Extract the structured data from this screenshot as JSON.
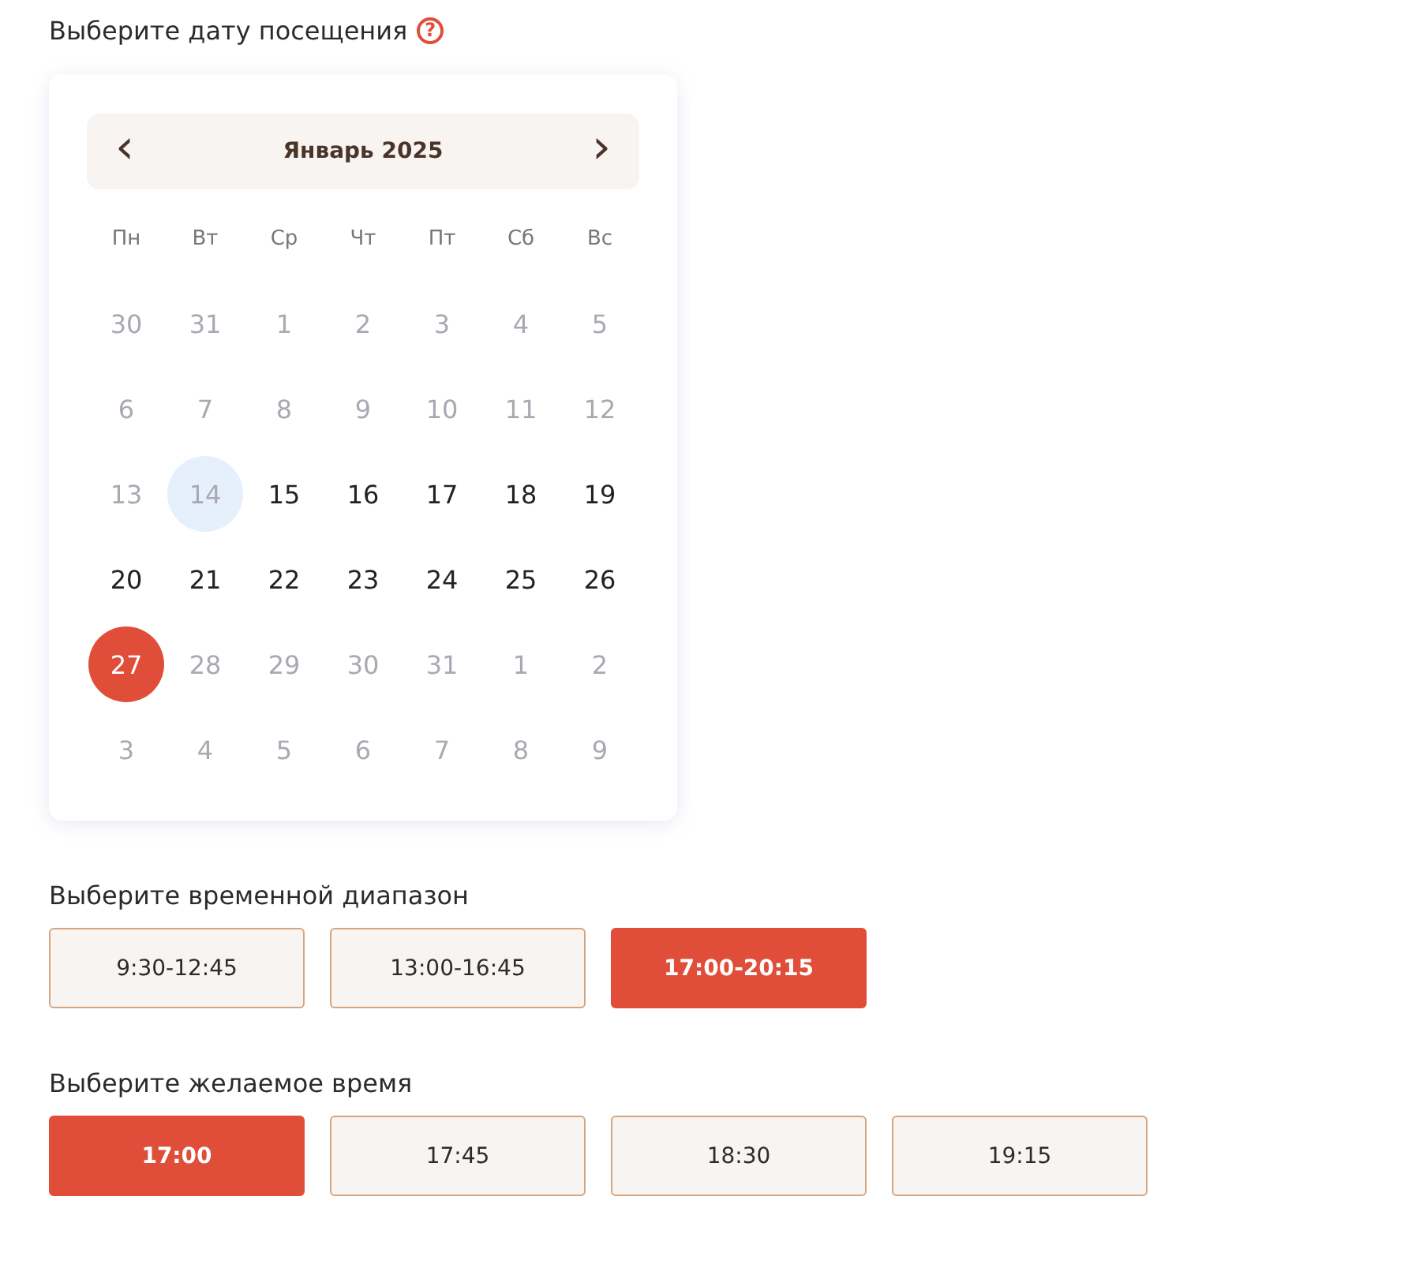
{
  "date_section": {
    "title": "Выберите дату посещения",
    "help_icon": "?"
  },
  "calendar": {
    "month": "Январь 2025",
    "prev": "‹",
    "next": "›",
    "weekdays": [
      "Пн",
      "Вт",
      "Ср",
      "Чт",
      "Пт",
      "Сб",
      "Вс"
    ],
    "weeks": [
      [
        {
          "day": "30",
          "disabled": true,
          "selected": false,
          "highlighted": false
        },
        {
          "day": "31",
          "disabled": true,
          "selected": false,
          "highlighted": false
        },
        {
          "day": "1",
          "disabled": true,
          "selected": false,
          "highlighted": false
        },
        {
          "day": "2",
          "disabled": true,
          "selected": false,
          "highlighted": false
        },
        {
          "day": "3",
          "disabled": true,
          "selected": false,
          "highlighted": false
        },
        {
          "day": "4",
          "disabled": true,
          "selected": false,
          "highlighted": false
        },
        {
          "day": "5",
          "disabled": true,
          "selected": false,
          "highlighted": false
        }
      ],
      [
        {
          "day": "6",
          "disabled": true,
          "selected": false,
          "highlighted": false
        },
        {
          "day": "7",
          "disabled": true,
          "selected": false,
          "highlighted": false
        },
        {
          "day": "8",
          "disabled": true,
          "selected": false,
          "highlighted": false
        },
        {
          "day": "9",
          "disabled": true,
          "selected": false,
          "highlighted": false
        },
        {
          "day": "10",
          "disabled": true,
          "selected": false,
          "highlighted": false
        },
        {
          "day": "11",
          "disabled": true,
          "selected": false,
          "highlighted": false
        },
        {
          "day": "12",
          "disabled": true,
          "selected": false,
          "highlighted": false
        }
      ],
      [
        {
          "day": "13",
          "disabled": true,
          "selected": false,
          "highlighted": false
        },
        {
          "day": "14",
          "disabled": true,
          "selected": false,
          "highlighted": true
        },
        {
          "day": "15",
          "disabled": false,
          "selected": false,
          "highlighted": false
        },
        {
          "day": "16",
          "disabled": false,
          "selected": false,
          "highlighted": false
        },
        {
          "day": "17",
          "disabled": false,
          "selected": false,
          "highlighted": false
        },
        {
          "day": "18",
          "disabled": false,
          "selected": false,
          "highlighted": false
        },
        {
          "day": "19",
          "disabled": false,
          "selected": false,
          "highlighted": false
        }
      ],
      [
        {
          "day": "20",
          "disabled": false,
          "selected": false,
          "highlighted": false
        },
        {
          "day": "21",
          "disabled": false,
          "selected": false,
          "highlighted": false
        },
        {
          "day": "22",
          "disabled": false,
          "selected": false,
          "highlighted": false
        },
        {
          "day": "23",
          "disabled": false,
          "selected": false,
          "highlighted": false
        },
        {
          "day": "24",
          "disabled": false,
          "selected": false,
          "highlighted": false
        },
        {
          "day": "25",
          "disabled": false,
          "selected": false,
          "highlighted": false
        },
        {
          "day": "26",
          "disabled": false,
          "selected": false,
          "highlighted": false
        }
      ],
      [
        {
          "day": "27",
          "disabled": false,
          "selected": true,
          "highlighted": false
        },
        {
          "day": "28",
          "disabled": true,
          "selected": false,
          "highlighted": false
        },
        {
          "day": "29",
          "disabled": true,
          "selected": false,
          "highlighted": false
        },
        {
          "day": "30",
          "disabled": true,
          "selected": false,
          "highlighted": false
        },
        {
          "day": "31",
          "disabled": true,
          "selected": false,
          "highlighted": false
        },
        {
          "day": "1",
          "disabled": true,
          "selected": false,
          "highlighted": false
        },
        {
          "day": "2",
          "disabled": true,
          "selected": false,
          "highlighted": false
        }
      ],
      [
        {
          "day": "3",
          "disabled": true,
          "selected": false,
          "highlighted": false
        },
        {
          "day": "4",
          "disabled": true,
          "selected": false,
          "highlighted": false
        },
        {
          "day": "5",
          "disabled": true,
          "selected": false,
          "highlighted": false
        },
        {
          "day": "6",
          "disabled": true,
          "selected": false,
          "highlighted": false
        },
        {
          "day": "7",
          "disabled": true,
          "selected": false,
          "highlighted": false
        },
        {
          "day": "8",
          "disabled": true,
          "selected": false,
          "highlighted": false
        },
        {
          "day": "9",
          "disabled": true,
          "selected": false,
          "highlighted": false
        }
      ]
    ]
  },
  "range_section": {
    "title": "Выберите временной диапазон",
    "options": [
      {
        "label": "9:30-12:45",
        "selected": false
      },
      {
        "label": "13:00-16:45",
        "selected": false
      },
      {
        "label": "17:00-20:15",
        "selected": true
      }
    ]
  },
  "time_section": {
    "title": "Выберите желаемое время",
    "options": [
      {
        "label": "17:00",
        "selected": true
      },
      {
        "label": "17:45",
        "selected": false
      },
      {
        "label": "18:30",
        "selected": false
      },
      {
        "label": "19:15",
        "selected": false
      }
    ]
  }
}
